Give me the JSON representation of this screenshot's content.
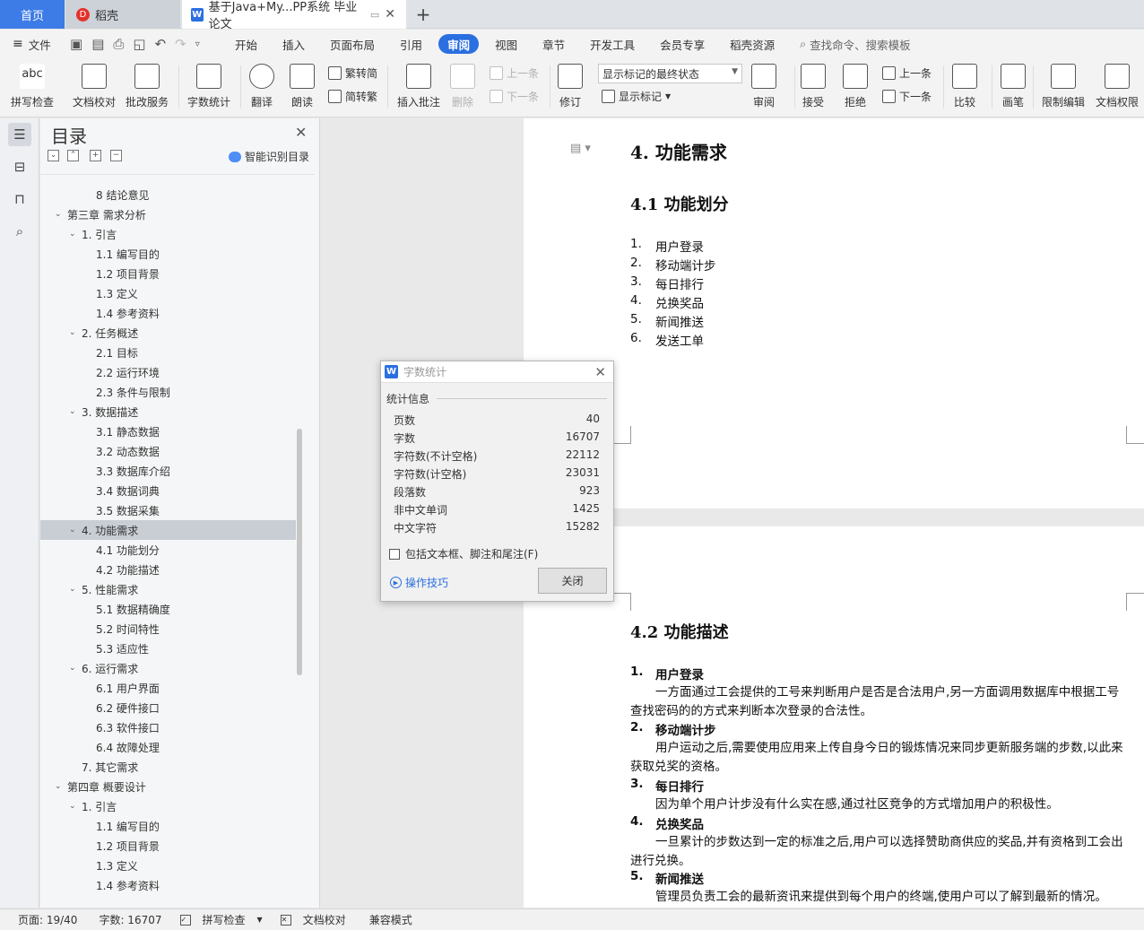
{
  "tabs": {
    "home": "首页",
    "daoke": "稻壳",
    "doc": "基于Java+My...PP系统 毕业论文"
  },
  "menu": {
    "file": "文件",
    "items": [
      "开始",
      "插入",
      "页面布局",
      "引用",
      "审阅",
      "视图",
      "章节",
      "开发工具",
      "会员专享",
      "稻壳资源"
    ],
    "active": "审阅",
    "search_placeholder": "查找命令、搜索模板"
  },
  "ribbon": {
    "spell": "拼写检查",
    "doc_check": "文档校对",
    "revise_service": "批改服务",
    "word_count": "字数统计",
    "translate": "翻译",
    "read_aloud": "朗读",
    "trad_to_simp": "繁转简",
    "simp_to_trad": "简转繁",
    "insert_comment": "插入批注",
    "delete": "删除",
    "prev": "上一条",
    "next": "下一条",
    "track": "修订",
    "markup_state": "显示标记的最终状态",
    "show_markup": "显示标记",
    "review": "审阅",
    "accept": "接受",
    "reject": "拒绝",
    "prev2": "上一条",
    "next2": "下一条",
    "compare": "比较",
    "pen": "画笔",
    "restrict_edit": "限制编辑",
    "doc_rights": "文档权限"
  },
  "outline": {
    "title": "目录",
    "smart_toc": "智能识别目录",
    "items": [
      {
        "text": "8 结论意见",
        "level": 2,
        "caret": ""
      },
      {
        "text": "第三章 需求分析",
        "level": 0,
        "caret": "v"
      },
      {
        "text": "1. 引言",
        "level": 1,
        "caret": "v"
      },
      {
        "text": "1.1 编写目的",
        "level": 2,
        "caret": ""
      },
      {
        "text": "1.2 项目背景",
        "level": 2,
        "caret": ""
      },
      {
        "text": "1.3 定义",
        "level": 2,
        "caret": ""
      },
      {
        "text": "1.4 参考资料",
        "level": 2,
        "caret": ""
      },
      {
        "text": "2. 任务概述",
        "level": 1,
        "caret": "v"
      },
      {
        "text": "2.1 目标",
        "level": 2,
        "caret": ""
      },
      {
        "text": "2.2 运行环境",
        "level": 2,
        "caret": ""
      },
      {
        "text": "2.3 条件与限制",
        "level": 2,
        "caret": ""
      },
      {
        "text": "3. 数据描述",
        "level": 1,
        "caret": "v"
      },
      {
        "text": "3.1 静态数据",
        "level": 2,
        "caret": ""
      },
      {
        "text": "3.2 动态数据",
        "level": 2,
        "caret": ""
      },
      {
        "text": "3.3 数据库介绍",
        "level": 2,
        "caret": ""
      },
      {
        "text": "3.4 数据词典",
        "level": 2,
        "caret": ""
      },
      {
        "text": "3.5 数据采集",
        "level": 2,
        "caret": ""
      },
      {
        "text": "4. 功能需求",
        "level": 1,
        "caret": "v",
        "selected": true
      },
      {
        "text": "4.1 功能划分",
        "level": 2,
        "caret": ""
      },
      {
        "text": "4.2 功能描述",
        "level": 2,
        "caret": ""
      },
      {
        "text": "5. 性能需求",
        "level": 1,
        "caret": "v"
      },
      {
        "text": "5.1 数据精确度",
        "level": 2,
        "caret": ""
      },
      {
        "text": "5.2 时间特性",
        "level": 2,
        "caret": ""
      },
      {
        "text": "5.3 适应性",
        "level": 2,
        "caret": ""
      },
      {
        "text": "6. 运行需求",
        "level": 1,
        "caret": "v"
      },
      {
        "text": "6.1 用户界面",
        "level": 2,
        "caret": ""
      },
      {
        "text": "6.2 硬件接口",
        "level": 2,
        "caret": ""
      },
      {
        "text": "6.3 软件接口",
        "level": 2,
        "caret": ""
      },
      {
        "text": "6.4 故障处理",
        "level": 2,
        "caret": ""
      },
      {
        "text": "7. 其它需求",
        "level": 1,
        "caret": ""
      },
      {
        "text": "第四章 概要设计",
        "level": 0,
        "caret": "v"
      },
      {
        "text": "1. 引言",
        "level": 1,
        "caret": "v"
      },
      {
        "text": "1.1 编写目的",
        "level": 2,
        "caret": ""
      },
      {
        "text": "1.2 项目背景",
        "level": 2,
        "caret": ""
      },
      {
        "text": "1.3 定义",
        "level": 2,
        "caret": ""
      },
      {
        "text": "1.4 参考资料",
        "level": 2,
        "caret": ""
      }
    ]
  },
  "document": {
    "heading": "4.  功能需求",
    "sub1": "4.1 功能划分",
    "list": [
      {
        "n": "1.",
        "t": "用户登录"
      },
      {
        "n": "2.",
        "t": "移动端计步"
      },
      {
        "n": "3.",
        "t": "每日排行"
      },
      {
        "n": "4.",
        "t": "兑换奖品"
      },
      {
        "n": "5.",
        "t": "新闻推送"
      },
      {
        "n": "6.",
        "t": "发送工单"
      }
    ],
    "sub2": "4.2 功能描述",
    "details": [
      {
        "n": "1.",
        "t": "用户登录",
        "p": "一方面通过工会提供的工号来判断用户是否是合法用户,另一方面调用数据库中根据工号查找密码的的方式来判断本次登录的合法性。"
      },
      {
        "n": "2.",
        "t": "移动端计步",
        "p": "用户运动之后,需要使用应用来上传自身今日的锻炼情况来同步更新服务端的步数,以此来获取兑奖的资格。"
      },
      {
        "n": "3.",
        "t": "每日排行",
        "p": "因为单个用户计步没有什么实在感,通过社区竞争的方式增加用户的积极性。"
      },
      {
        "n": "4.",
        "t": "兑换奖品",
        "p": "一旦累计的步数达到一定的标准之后,用户可以选择赞助商供应的奖品,并有资格到工会出进行兑换。"
      },
      {
        "n": "5.",
        "t": "新闻推送",
        "p": "管理员负责工会的最新资讯来提供到每个用户的终端,使用户可以了解到最新的情况。"
      }
    ]
  },
  "dialog": {
    "title": "字数统计",
    "section": "统计信息",
    "stats": [
      {
        "label": "页数",
        "value": "40"
      },
      {
        "label": "字数",
        "value": "16707"
      },
      {
        "label": "字符数(不计空格)",
        "value": "22112"
      },
      {
        "label": "字符数(计空格)",
        "value": "23031"
      },
      {
        "label": "段落数",
        "value": "923"
      },
      {
        "label": "非中文单词",
        "value": "1425"
      },
      {
        "label": "中文字符",
        "value": "15282"
      }
    ],
    "include_label": "包括文本框、脚注和尾注(F)",
    "tips": "操作技巧",
    "close": "关闭"
  },
  "status": {
    "page": "页面: 19/40",
    "words": "字数: 16707",
    "spell": "拼写检查",
    "doc_check": "文档校对",
    "compat": "兼容模式"
  }
}
